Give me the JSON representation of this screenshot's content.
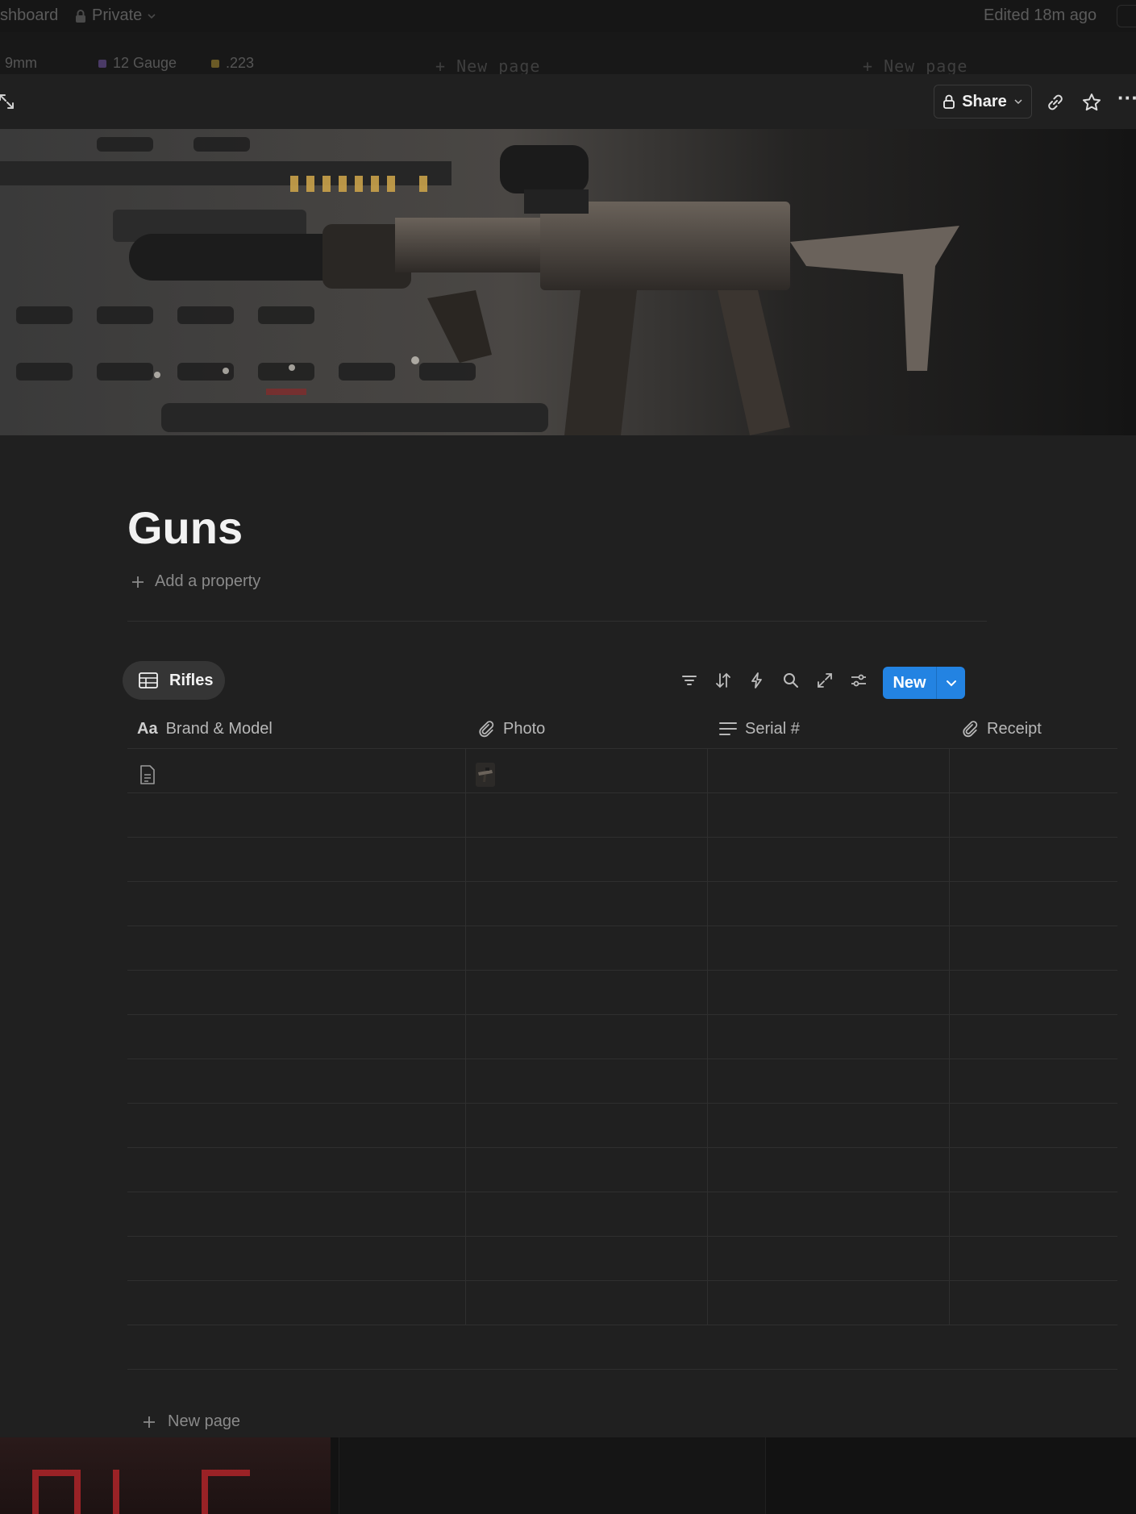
{
  "background": {
    "breadcrumb": "shboard",
    "privacy": "Private",
    "edited": "Edited 18m ago",
    "tags": [
      {
        "label": "9mm",
        "color": "#4a4a4a"
      },
      {
        "label": "12 Gauge",
        "color": "#5a3f7a"
      },
      {
        "label": ".223",
        "color": "#7a6a2a"
      }
    ],
    "new_page_left": "+ New page",
    "new_page_right": "+ New page"
  },
  "header": {
    "share_label": "Share",
    "more_label": "···"
  },
  "page": {
    "title": "Guns",
    "add_property": "Add a property"
  },
  "database": {
    "view_tab": "Rifles",
    "new_button": "New",
    "columns": [
      {
        "label": "Brand & Model",
        "icon": "title-icon"
      },
      {
        "label": "Photo",
        "icon": "attachment-icon"
      },
      {
        "label": "Serial #",
        "icon": "text-lines-icon"
      },
      {
        "label": "Receipt",
        "icon": "attachment-icon"
      }
    ],
    "title_icon_text": "Aa",
    "row_count": 13,
    "new_page_label": "New page"
  },
  "colors": {
    "accent": "#2383e2",
    "background": "#191919",
    "panel": "#202020"
  }
}
